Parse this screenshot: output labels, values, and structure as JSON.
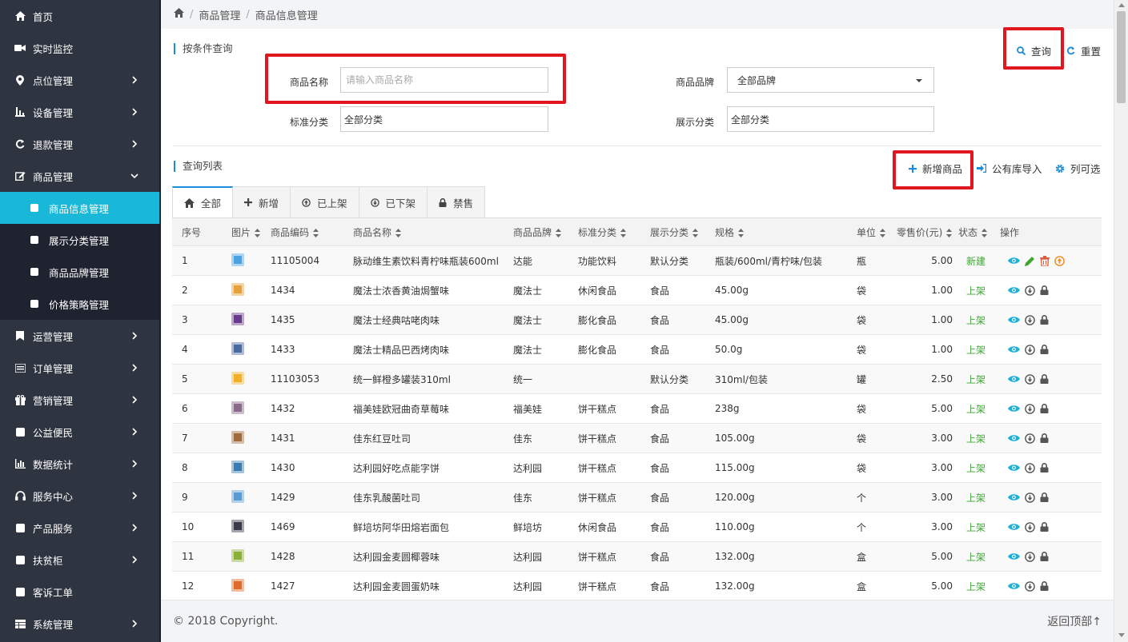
{
  "sidebar": {
    "items": [
      {
        "label": "首页",
        "icon": "home-icon",
        "chevron": false
      },
      {
        "label": "实时监控",
        "icon": "video-camera-icon",
        "chevron": false
      },
      {
        "label": "点位管理",
        "icon": "map-marker-icon",
        "chevron": true
      },
      {
        "label": "设备管理",
        "icon": "sliders-icon",
        "chevron": true
      },
      {
        "label": "退款管理",
        "icon": "refresh-icon",
        "chevron": true
      },
      {
        "label": "商品管理",
        "icon": "edit-icon",
        "chevron": true,
        "expanded": true
      }
    ],
    "subitems": [
      {
        "label": "商品信息管理",
        "active": true
      },
      {
        "label": "展示分类管理",
        "active": false
      },
      {
        "label": "商品品牌管理",
        "active": false
      },
      {
        "label": "价格策略管理",
        "active": false
      }
    ],
    "items_after": [
      {
        "label": "运营管理",
        "icon": "bookmark-icon",
        "chevron": true
      },
      {
        "label": "订单管理",
        "icon": "list-icon",
        "chevron": true
      },
      {
        "label": "营销管理",
        "icon": "gift-icon",
        "chevron": true
      },
      {
        "label": "公益便民",
        "icon": "square-icon",
        "chevron": true
      },
      {
        "label": "数据统计",
        "icon": "bar-chart-icon",
        "chevron": true
      },
      {
        "label": "服务中心",
        "icon": "headphones-icon",
        "chevron": true
      },
      {
        "label": "产品服务",
        "icon": "square-icon",
        "chevron": true
      },
      {
        "label": "扶贫柜",
        "icon": "square-icon",
        "chevron": true
      },
      {
        "label": "客诉工单",
        "icon": "square-icon",
        "chevron": false
      },
      {
        "label": "系统管理",
        "icon": "table-icon",
        "chevron": true
      }
    ]
  },
  "breadcrumb": {
    "level1": "商品管理",
    "level2": "商品信息管理"
  },
  "search": {
    "section_title": "按条件查询",
    "name_label": "商品名称",
    "name_placeholder": "请输入商品名称",
    "brand_label": "商品品牌",
    "brand_value": "全部品牌",
    "std_label": "标准分类",
    "std_value": "全部分类",
    "show_label": "展示分类",
    "show_value": "全部分类",
    "query_label": "查询",
    "reset_label": "重置"
  },
  "list": {
    "section_title": "查询列表",
    "add_label": "新增商品",
    "import_label": "公有库导入",
    "columns_label": "列可选"
  },
  "tabs": [
    {
      "label": "全部",
      "icon": "home-icon"
    },
    {
      "label": "新增",
      "icon": "plus-icon"
    },
    {
      "label": "已上架",
      "icon": "circle-arrow-up-icon"
    },
    {
      "label": "已下架",
      "icon": "circle-arrow-down-icon"
    },
    {
      "label": "禁售",
      "icon": "lock-icon"
    }
  ],
  "table": {
    "headers": [
      "序号",
      "图片",
      "商品编码",
      "商品名称",
      "商品品牌",
      "标准分类",
      "展示分类",
      "规格",
      "单位",
      "零售价(元)",
      "状态",
      "操作"
    ],
    "rows": [
      {
        "idx": "1",
        "code": "11105004",
        "name": "脉动维生素饮料青柠味瓶装600ml",
        "brand": "达能",
        "std": "功能饮料",
        "show": "默认分类",
        "spec": "瓶装/600ml/青柠味/包装",
        "unit": "瓶",
        "price": "5.00",
        "status": "新建",
        "thumb": "#4aa3e0",
        "new": true
      },
      {
        "idx": "2",
        "code": "1434",
        "name": "魔法士浓香黄油焗蟹味",
        "brand": "魔法士",
        "std": "休闲食品",
        "show": "食品",
        "spec": "45.00g",
        "unit": "袋",
        "price": "1.00",
        "status": "上架",
        "thumb": "#e6a13a"
      },
      {
        "idx": "3",
        "code": "1435",
        "name": "魔法士经典咕咾肉味",
        "brand": "魔法士",
        "std": "膨化食品",
        "show": "食品",
        "spec": "45.00g",
        "unit": "袋",
        "price": "1.00",
        "status": "上架",
        "thumb": "#6a3a8c"
      },
      {
        "idx": "4",
        "code": "1433",
        "name": "魔法士精品巴西烤肉味",
        "brand": "魔法士",
        "std": "膨化食品",
        "show": "食品",
        "spec": "50.0g",
        "unit": "袋",
        "price": "1.00",
        "status": "上架",
        "thumb": "#4a6aa0"
      },
      {
        "idx": "5",
        "code": "11103053",
        "name": "统一鲜橙多罐装310ml",
        "brand": "统一",
        "std": "",
        "show": "默认分类",
        "spec": "310ml/包装",
        "unit": "罐",
        "price": "2.50",
        "status": "上架",
        "thumb": "#f0b02a"
      },
      {
        "idx": "6",
        "code": "1432",
        "name": "福美娃欧冠曲奇草莓味",
        "brand": "福美娃",
        "std": "饼干糕点",
        "show": "食品",
        "spec": "238g",
        "unit": "袋",
        "price": "5.00",
        "status": "上架",
        "thumb": "#8a6a8a"
      },
      {
        "idx": "7",
        "code": "1431",
        "name": "佳东红豆吐司",
        "brand": "佳东",
        "std": "饼干糕点",
        "show": "食品",
        "spec": "105.00g",
        "unit": "袋",
        "price": "3.00",
        "status": "上架",
        "thumb": "#a06a3a"
      },
      {
        "idx": "8",
        "code": "1430",
        "name": "达利园好吃点能字饼",
        "brand": "达利园",
        "std": "饼干糕点",
        "show": "食品",
        "spec": "115.00g",
        "unit": "袋",
        "price": "3.00",
        "status": "上架",
        "thumb": "#3a7ab0"
      },
      {
        "idx": "9",
        "code": "1429",
        "name": "佳东乳酸菌吐司",
        "brand": "佳东",
        "std": "饼干糕点",
        "show": "食品",
        "spec": "120.00g",
        "unit": "个",
        "price": "3.00",
        "status": "上架",
        "thumb": "#5a9ad0"
      },
      {
        "idx": "10",
        "code": "1469",
        "name": "鲜培坊阿华田熔岩面包",
        "brand": "鲜培坊",
        "std": "休闲食品",
        "show": "食品",
        "spec": "110.00g",
        "unit": "个",
        "price": "3.00",
        "status": "上架",
        "thumb": "#3a3a4a"
      },
      {
        "idx": "11",
        "code": "1428",
        "name": "达利园金麦圆椰蓉味",
        "brand": "达利园",
        "std": "饼干糕点",
        "show": "食品",
        "spec": "132.00g",
        "unit": "盒",
        "price": "5.00",
        "status": "上架",
        "thumb": "#8ab03a"
      },
      {
        "idx": "12",
        "code": "1427",
        "name": "达利园金麦圆蛋奶味",
        "brand": "达利园",
        "std": "饼干糕点",
        "show": "食品",
        "spec": "132.00g",
        "unit": "盒",
        "price": "5.00",
        "status": "上架",
        "thumb": "#e06a2a"
      }
    ]
  },
  "footer": {
    "copyright": "© 2018 Copyright.",
    "back_to_top": "返回顶部↑"
  }
}
